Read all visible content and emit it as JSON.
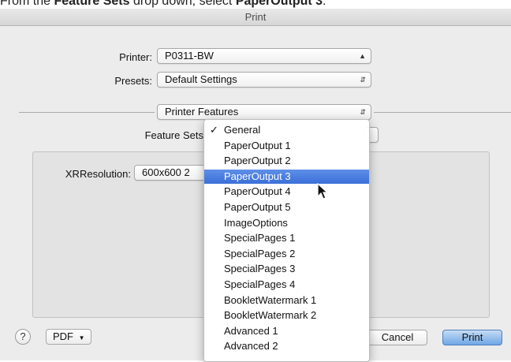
{
  "caption": {
    "prefix": "From the ",
    "field": "Feature Sets",
    "middle": " drop down, select ",
    "choice": "PaperOutput 3",
    "suffix": "."
  },
  "dialog": {
    "title": "Print",
    "printer_label": "Printer:",
    "printer_value": "P0311-BW",
    "presets_label": "Presets:",
    "presets_value": "Default Settings",
    "section_value": "Printer Features",
    "feature_sets_label": "Feature Sets"
  },
  "panel": {
    "xr_label": "XRResolution:",
    "xr_value": "600x600 2"
  },
  "menu": {
    "checked_item": "General",
    "selected_item": "PaperOutput 3",
    "items": [
      "General",
      "PaperOutput 1",
      "PaperOutput 2",
      "PaperOutput 3",
      "PaperOutput 4",
      "PaperOutput 5",
      "ImageOptions",
      "SpecialPages 1",
      "SpecialPages 2",
      "SpecialPages 3",
      "SpecialPages 4",
      "BookletWatermark 1",
      "BookletWatermark 2",
      "Advanced 1",
      "Advanced 2"
    ]
  },
  "footer": {
    "help_label": "?",
    "pdf_label": "PDF",
    "cancel_label": "Cancel",
    "print_label": "Print"
  },
  "icons": {
    "popup_arrows": "up-down-arrows-icon",
    "checkmark": "checkmark-icon",
    "cursor": "mouse-pointer-icon"
  },
  "colors": {
    "selection": "#3a6fd8",
    "print_button": "#6fa7e6"
  }
}
